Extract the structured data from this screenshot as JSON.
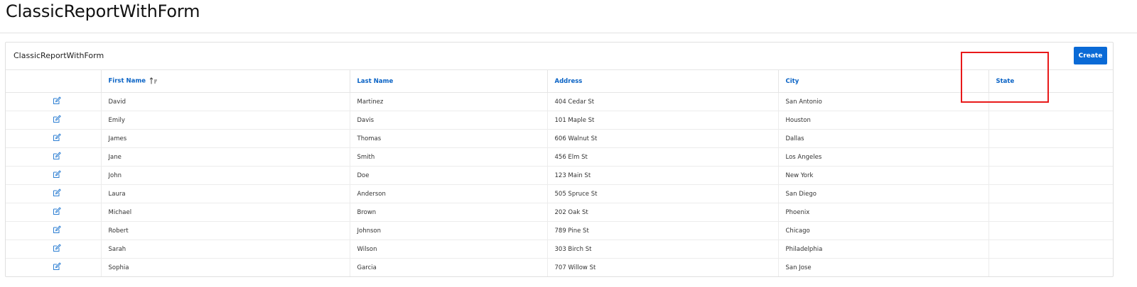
{
  "page": {
    "title": "ClassicReportWithForm"
  },
  "region": {
    "title": "ClassicReportWithForm",
    "create_label": "Create"
  },
  "table": {
    "columns": {
      "first_name": "First Name",
      "last_name": "Last Name",
      "address": "Address",
      "city": "City",
      "state": "State"
    },
    "rows": [
      {
        "first_name": "David",
        "last_name": "Martinez",
        "address": "404 Cedar St",
        "city": "San Antonio",
        "state": ""
      },
      {
        "first_name": "Emily",
        "last_name": "Davis",
        "address": "101 Maple St",
        "city": "Houston",
        "state": ""
      },
      {
        "first_name": "James",
        "last_name": "Thomas",
        "address": "606 Walnut St",
        "city": "Dallas",
        "state": ""
      },
      {
        "first_name": "Jane",
        "last_name": "Smith",
        "address": "456 Elm St",
        "city": "Los Angeles",
        "state": ""
      },
      {
        "first_name": "John",
        "last_name": "Doe",
        "address": "123 Main St",
        "city": "New York",
        "state": ""
      },
      {
        "first_name": "Laura",
        "last_name": "Anderson",
        "address": "505 Spruce St",
        "city": "San Diego",
        "state": ""
      },
      {
        "first_name": "Michael",
        "last_name": "Brown",
        "address": "202 Oak St",
        "city": "Phoenix",
        "state": ""
      },
      {
        "first_name": "Robert",
        "last_name": "Johnson",
        "address": "789 Pine St",
        "city": "Chicago",
        "state": ""
      },
      {
        "first_name": "Sarah",
        "last_name": "Wilson",
        "address": "303 Birch St",
        "city": "Philadelphia",
        "state": ""
      },
      {
        "first_name": "Sophia",
        "last_name": "Garcia",
        "address": "707 Willow St",
        "city": "San Jose",
        "state": ""
      }
    ]
  },
  "icons": {
    "edit": "edit-icon",
    "sort": "sort-ascending-icon"
  },
  "colors": {
    "accent": "#0a6ad6",
    "link": "#0a63c5",
    "highlight": "#e8191a"
  }
}
